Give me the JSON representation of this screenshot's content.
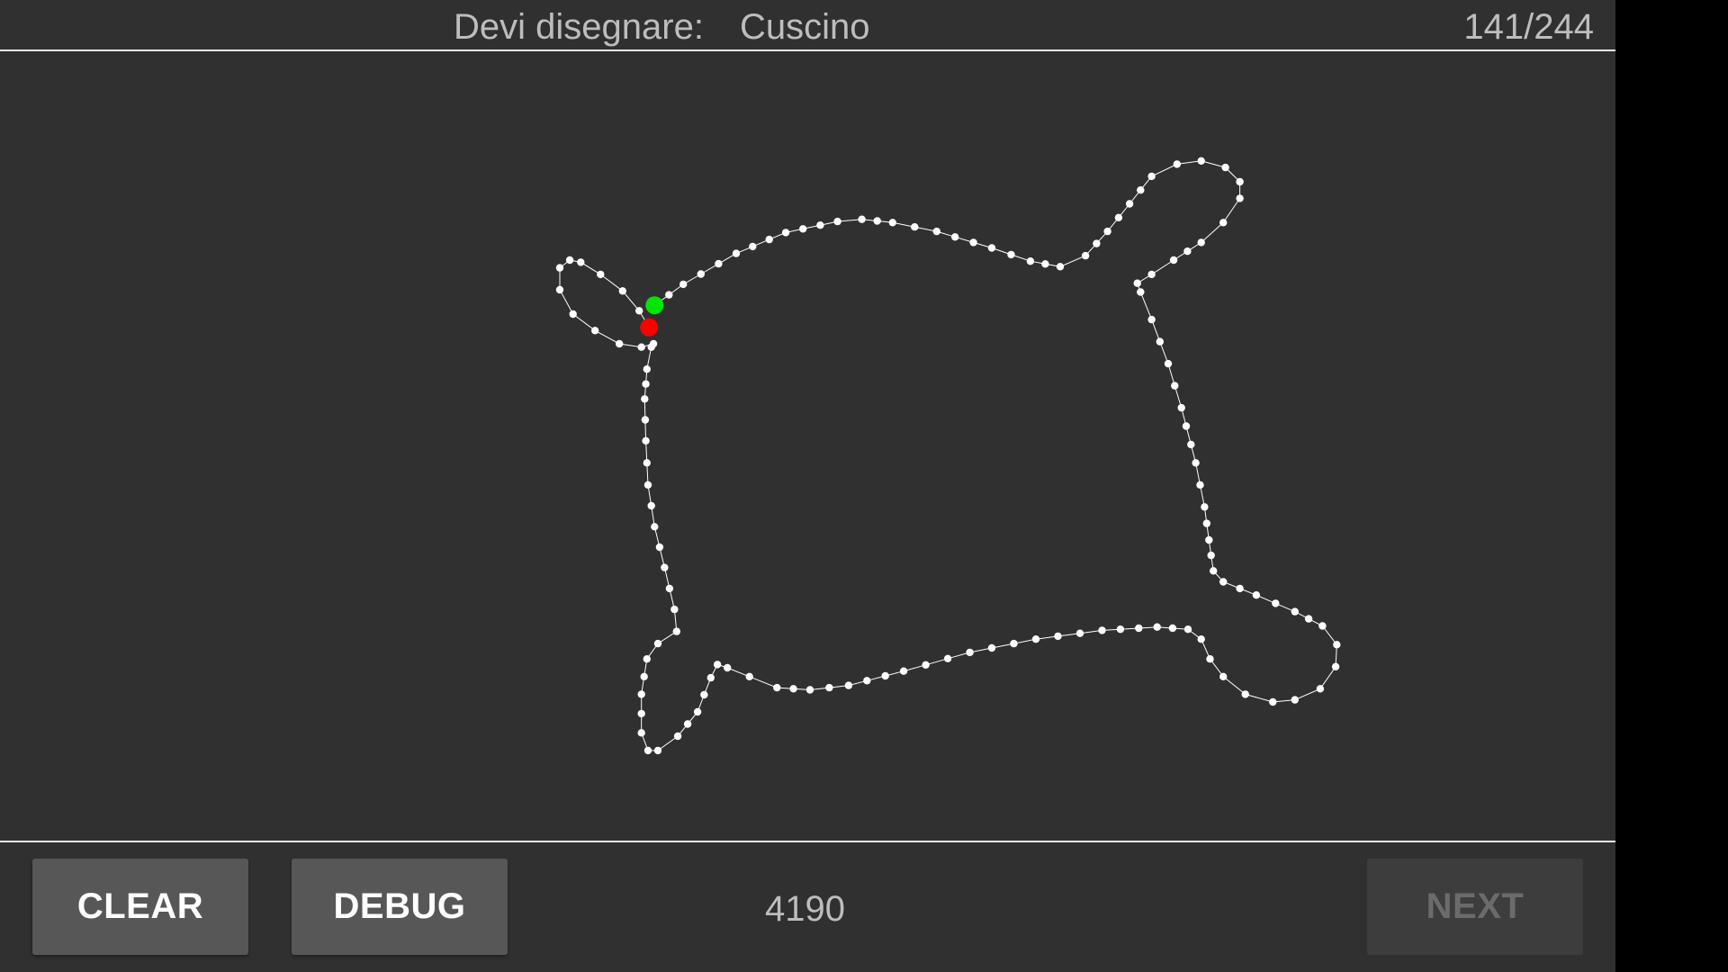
{
  "header": {
    "prompt_label": "Devi disegnare:",
    "prompt_word": "Cuscino",
    "progress": "141/244"
  },
  "footer": {
    "clear_label": "CLEAR",
    "debug_label": "DEBUG",
    "score": "4190",
    "next_label": "NEXT"
  },
  "colors": {
    "background": "#303030",
    "stroke": "#ffffff",
    "start_marker": "#00e600",
    "end_marker": "#ff0000",
    "button": "#575757",
    "button_disabled": "#3d3d3d"
  }
}
